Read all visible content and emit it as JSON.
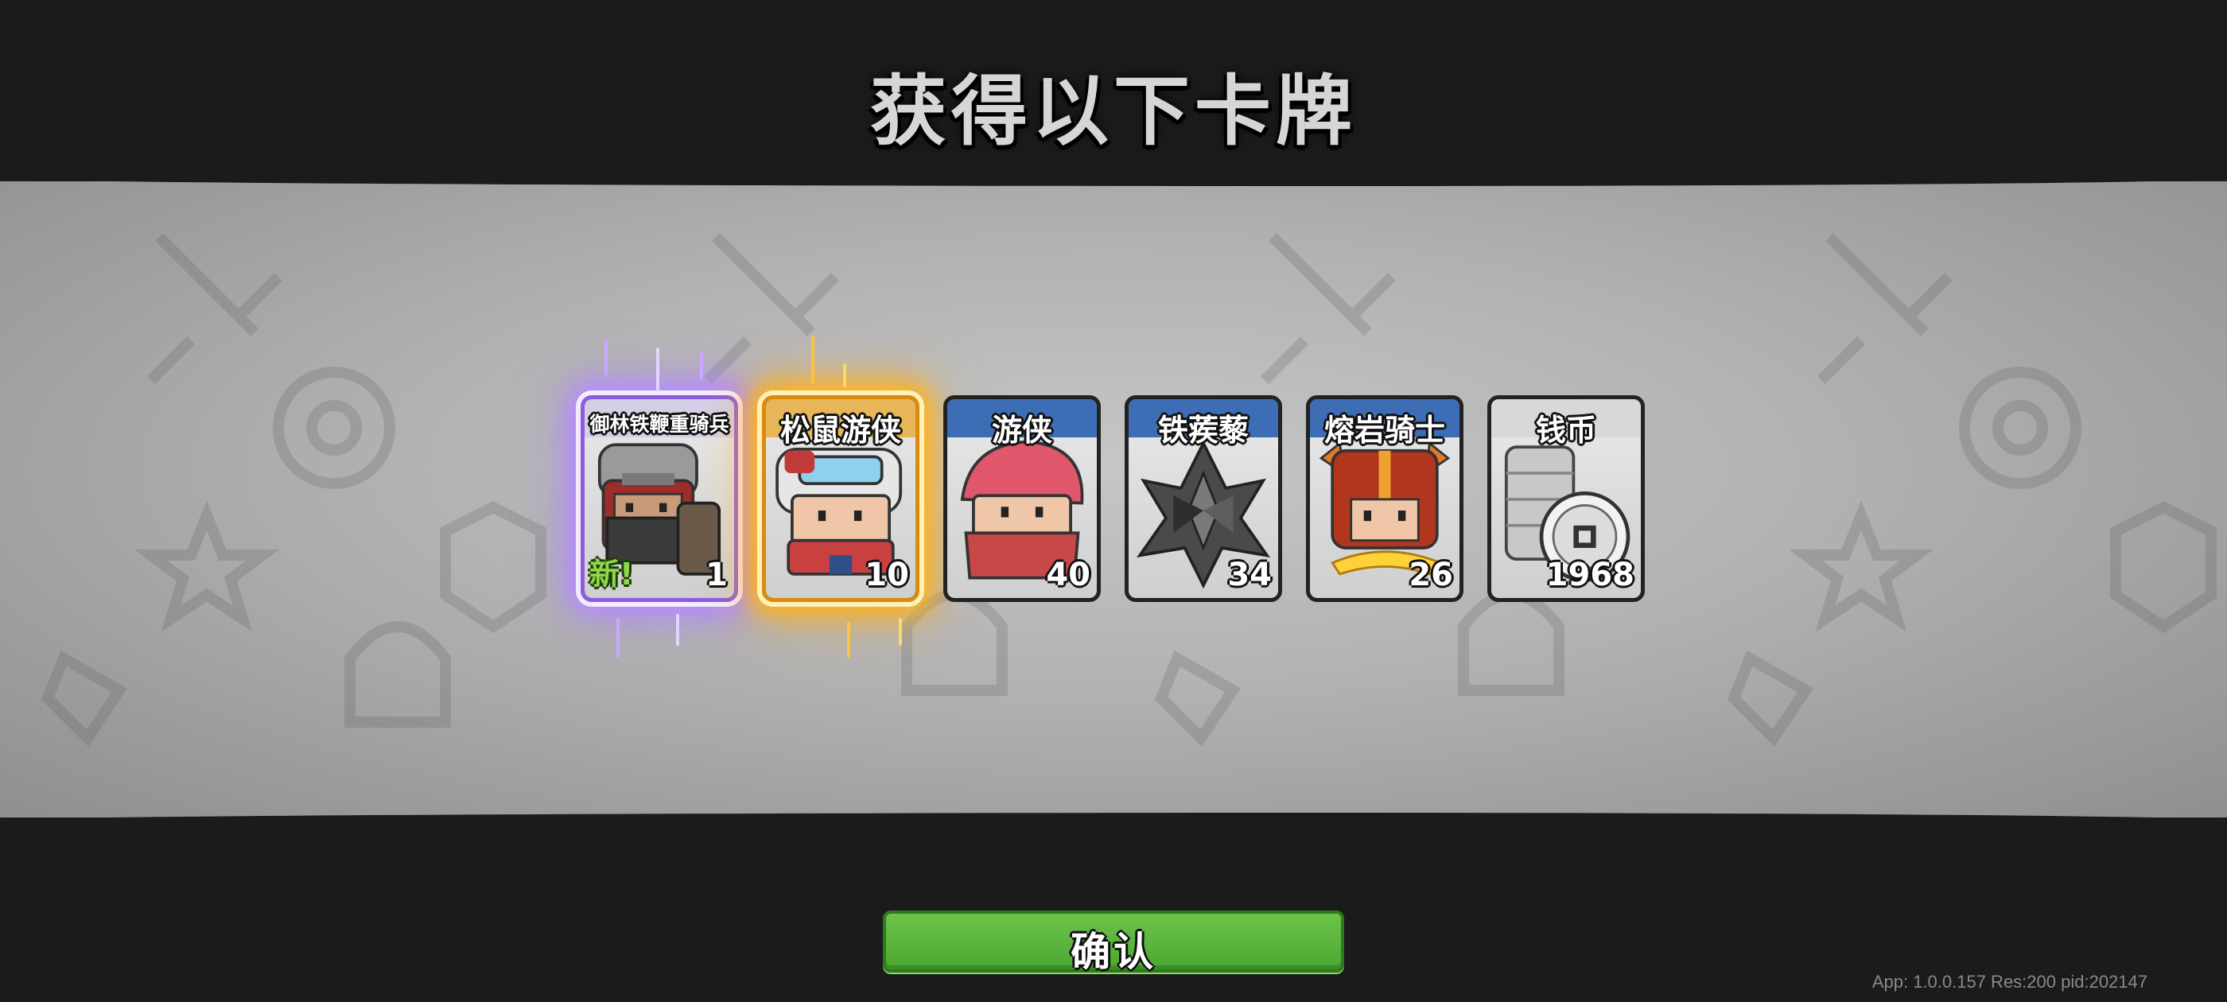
{
  "header": {
    "title": "获得以下卡牌"
  },
  "cards": [
    {
      "name": "御林铁鞭重骑兵",
      "count": "1",
      "new_label": "新!",
      "rarity": "epic",
      "glow_color": "#b58cff"
    },
    {
      "name": "松鼠游侠",
      "count": "10",
      "rarity": "legendary",
      "glow_color": "#ffb31a"
    },
    {
      "name": "游侠",
      "count": "40",
      "rarity": "rare",
      "header_color": "#3d6db4"
    },
    {
      "name": "铁蒺藜",
      "count": "34",
      "rarity": "rare",
      "header_color": "#3d6db4"
    },
    {
      "name": "熔岩骑士",
      "count": "26",
      "rarity": "rare",
      "header_color": "#3d6db4"
    },
    {
      "name": "钱币",
      "count": "1968",
      "rarity": "common",
      "header_color": "#d8d8d8"
    }
  ],
  "footer": {
    "confirm_label": "确认",
    "version_text": "App: 1.0.0.157 Res:200 pid:202147"
  },
  "colors": {
    "background": "#1b1b1b",
    "confirm_button": "#5bb63e",
    "accent_purple": "#8c5be0",
    "accent_gold": "#d98b10"
  }
}
